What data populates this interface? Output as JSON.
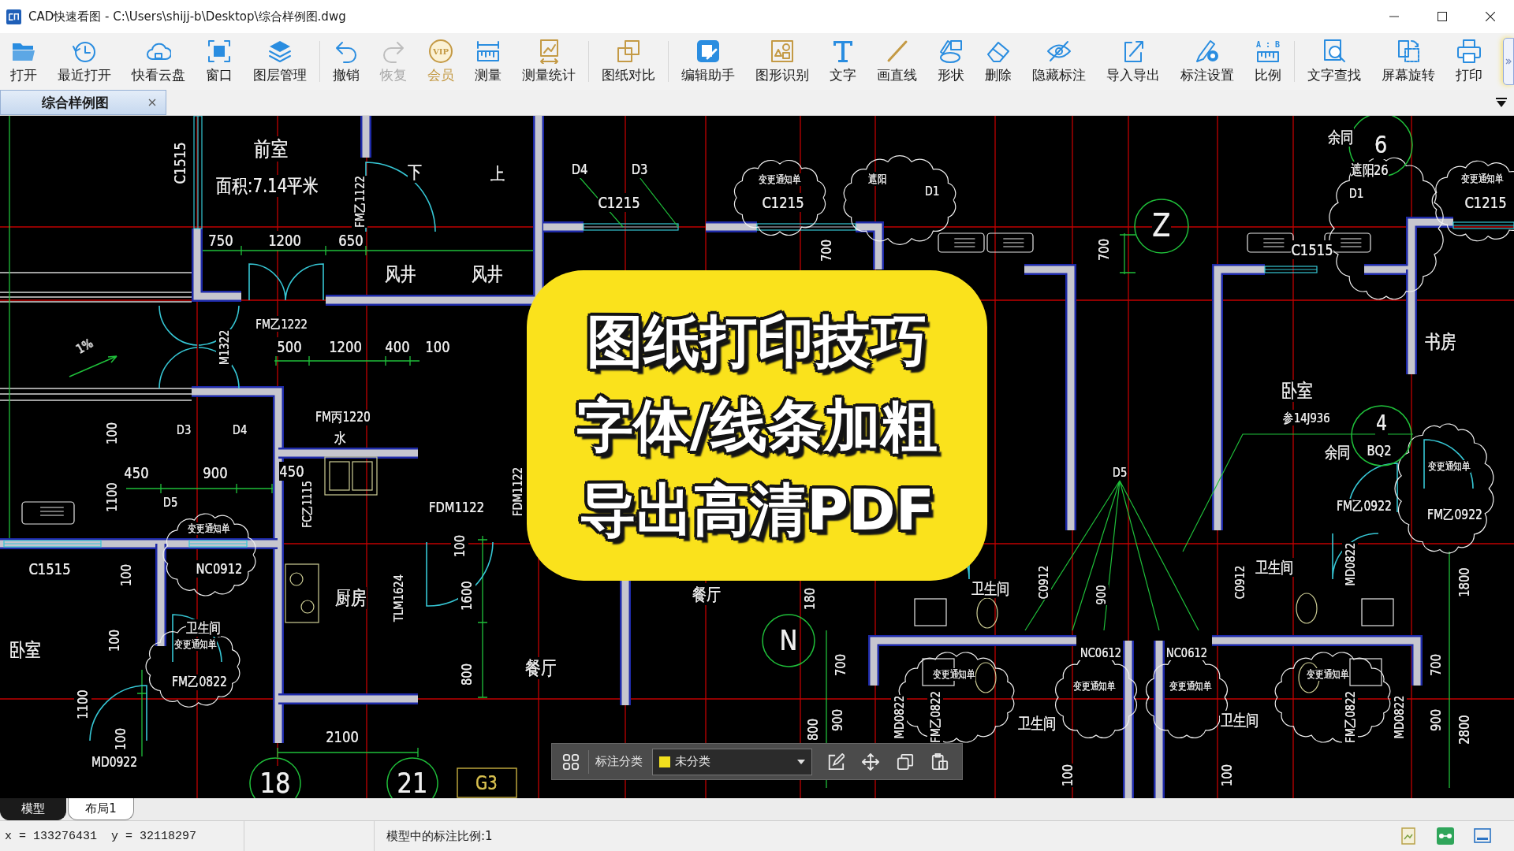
{
  "window": {
    "title": "CAD快速看图 - C:\\Users\\shijj-b\\Desktop\\综合样例图.dwg"
  },
  "toolbar": {
    "groups": [
      [
        {
          "label": "打开",
          "kind": "tool",
          "disabled": false
        },
        {
          "label": "最近打开",
          "kind": "tool",
          "disabled": false
        },
        {
          "label": "快看云盘",
          "kind": "tool",
          "disabled": false
        },
        {
          "label": "窗口",
          "kind": "tool",
          "disabled": false
        },
        {
          "label": "图层管理",
          "kind": "tool",
          "disabled": false
        }
      ],
      [
        {
          "label": "撤销",
          "kind": "tool",
          "disabled": false
        },
        {
          "label": "恢复",
          "kind": "tool",
          "disabled": true
        },
        {
          "label": "会员",
          "kind": "premium",
          "disabled": false,
          "badge": "VIP"
        },
        {
          "label": "测量",
          "kind": "tool",
          "disabled": false
        },
        {
          "label": "测量统计",
          "kind": "tool",
          "disabled": false
        }
      ],
      [
        {
          "label": "图纸对比",
          "kind": "tool",
          "disabled": false
        }
      ],
      [
        {
          "label": "编辑助手",
          "kind": "tool",
          "disabled": false
        },
        {
          "label": "图形识别",
          "kind": "tool",
          "disabled": false
        },
        {
          "label": "文字",
          "kind": "tool",
          "disabled": false
        },
        {
          "label": "画直线",
          "kind": "tool",
          "disabled": false
        },
        {
          "label": "形状",
          "kind": "tool",
          "disabled": false
        },
        {
          "label": "删除",
          "kind": "tool",
          "disabled": false
        },
        {
          "label": "隐藏标注",
          "kind": "tool",
          "disabled": false
        },
        {
          "label": "导入导出",
          "kind": "tool",
          "disabled": false
        },
        {
          "label": "标注设置",
          "kind": "tool",
          "disabled": false
        },
        {
          "label": "比例",
          "kind": "tool",
          "disabled": false,
          "badge": "A : B"
        }
      ],
      [
        {
          "label": "文字查找",
          "kind": "tool",
          "disabled": false
        },
        {
          "label": "屏幕旋转",
          "kind": "tool",
          "disabled": false
        },
        {
          "label": "打印",
          "kind": "tool",
          "disabled": false
        }
      ]
    ]
  },
  "document_tabs": [
    {
      "label": "综合样例图",
      "selected": true
    }
  ],
  "canvas": {
    "labels": [
      "前室",
      "面积:7.14平米",
      "C1515",
      "下",
      "上",
      "FM乙1122",
      "750",
      "1200",
      "650",
      "风井",
      "风井",
      "D4",
      "D3",
      "C1215",
      "变更通知单",
      "C1215",
      "遮阳",
      "D1",
      "700",
      "700",
      "余同",
      "遮阳26",
      "D1",
      "变更通知单",
      "C1215",
      "C1515",
      "书房",
      "卧室",
      "参14J936",
      "余同",
      "BQ2",
      "变更通知单",
      "FM乙0922",
      "FM乙0922",
      "D5",
      "FM乙1222",
      "500",
      "1200",
      "400",
      "100",
      "M1322",
      "1%",
      "FM丙1220",
      "水",
      "100",
      "D3",
      "D4",
      "450",
      "900",
      "450",
      "1100",
      "D5",
      "FC乙1115",
      "变更通知单",
      "FDM1122",
      "FDM1122",
      "C1515",
      "100",
      "NC0912",
      "厨房",
      "TLM1624",
      "100",
      "1600",
      "卧室",
      "100",
      "卫生间",
      "变更通知单",
      "FM乙0822",
      "800",
      "餐厅",
      "1100",
      "100",
      "2100",
      "MD0922",
      "G3",
      "餐厅",
      "180",
      "卫生间",
      "卫生间",
      "C0912",
      "C0912",
      "MD0822",
      "1800",
      "900",
      "NC0612",
      "NC0612",
      "700",
      "700",
      "变更通知单",
      "变更通知单",
      "变更通知单",
      "变更通知单",
      "MD0822",
      "FM乙0822",
      "FM乙0822",
      "MD0822",
      "卫生间",
      "卫生间",
      "800",
      "900",
      "900",
      "2800",
      "100",
      "100"
    ],
    "grid_bubbles": [
      "6",
      "Z",
      "4",
      "N",
      "18",
      "21"
    ]
  },
  "overlay": {
    "lines": [
      "图纸打印技巧",
      "字体/线条加粗",
      "导出高清PDF"
    ]
  },
  "annotation_toolbar": {
    "label": "标注分类",
    "category": {
      "value": "未分类",
      "color": "#f2e01e"
    }
  },
  "layout_tabs": [
    {
      "label": "模型",
      "selected": true
    },
    {
      "label": "布局1",
      "selected": false
    }
  ],
  "status_bar": {
    "coordinates": "x = 133276431  y = 32118297",
    "scale": "模型中的标注比例:1"
  }
}
